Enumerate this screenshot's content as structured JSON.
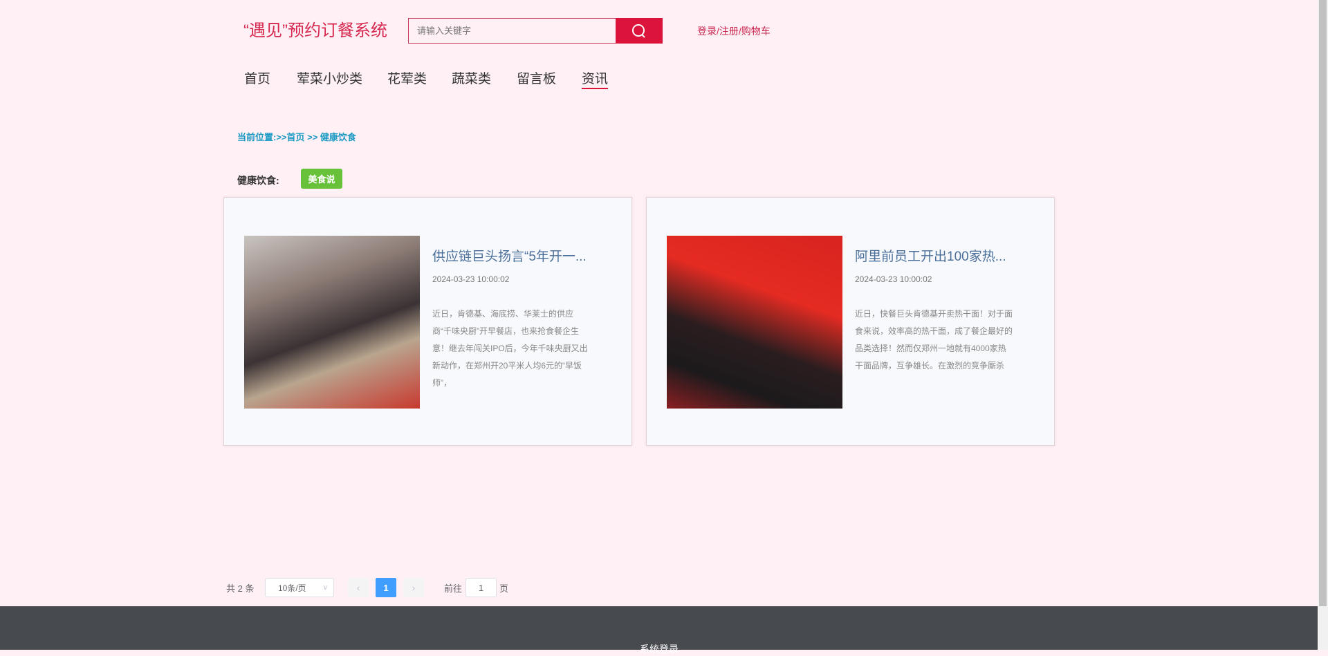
{
  "header": {
    "logo": "“遇见”预约订餐系统",
    "search_placeholder": "请输入关键字",
    "login": "登录/注册/购物车"
  },
  "nav": [
    {
      "label": "首页"
    },
    {
      "label": "荤菜小炒类"
    },
    {
      "label": "花荤类"
    },
    {
      "label": "蔬菜类"
    },
    {
      "label": "留言板"
    },
    {
      "label": "资讯",
      "active": true
    }
  ],
  "breadcrumb": "当前位置:>>首页 >> 健康饮食",
  "category": {
    "label": "健康饮食:",
    "tag": "美食说"
  },
  "articles": [
    {
      "title": "供应链巨头扬言“5年开一...",
      "date": "2024-03-23 10:00:02",
      "desc": "近日，肯德基、海底捞、华莱士的供应商“千味央厨”开早餐店，也来抢食餐企生意！继去年闯关IPO后，今年千味央厨又出新动作，在郑州开20平米人均6元的“早饭师”，"
    },
    {
      "title": "阿里前员工开出100家热...",
      "date": "2024-03-23 10:00:02",
      "desc": "近日，快餐巨头肯德基开卖热干面！对于面食来说，效率高的热干面，成了餐企最好的品类选择！然而仅郑州一地就有4000家热干面品牌，互争雄长。在激烈的竞争厮杀"
    }
  ],
  "pagination": {
    "total": "共 2 条",
    "page_size": "10条/页",
    "current": "1",
    "goto_label": "前往",
    "goto_value": "1",
    "page_suffix": "页"
  },
  "footer": {
    "link": "系统登录"
  }
}
